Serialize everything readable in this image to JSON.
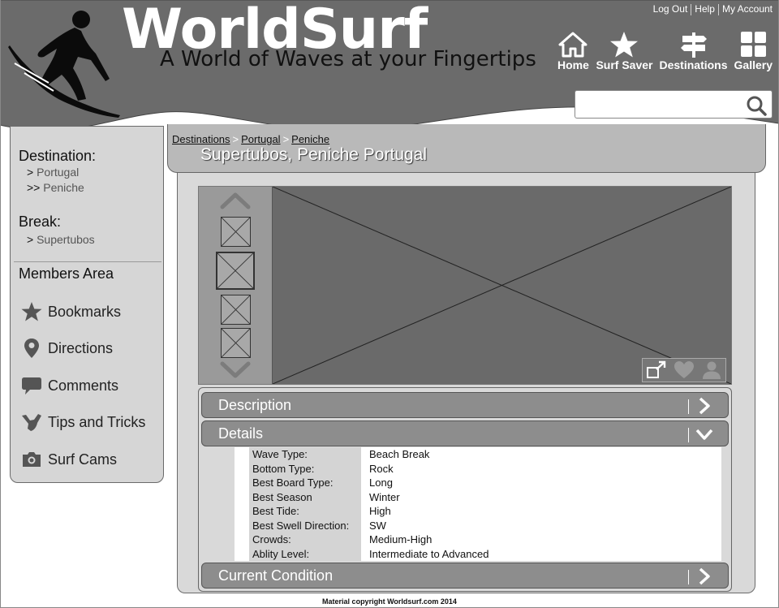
{
  "header": {
    "logo": "WorldSurf",
    "tagline": "A World of Waves at your Fingertips",
    "top_links": [
      "Log Out",
      "Help",
      "My Account"
    ],
    "nav": [
      {
        "label": "Home",
        "icon": "home-icon"
      },
      {
        "label": "Surf Saver",
        "icon": "star-icon"
      },
      {
        "label": "Destinations",
        "icon": "signpost-icon"
      },
      {
        "label": "Gallery",
        "icon": "grid-icon"
      }
    ],
    "search": {
      "value": "",
      "placeholder": ""
    }
  },
  "sidebar": {
    "destination_heading": "Destination:",
    "destination_items": [
      {
        "prefix": ">",
        "label": "Portugal"
      },
      {
        "prefix": ">>",
        "label": "Peniche"
      }
    ],
    "break_heading": "Break:",
    "break_items": [
      {
        "prefix": ">",
        "label": "Supertubos"
      }
    ],
    "members_heading": "Members Area",
    "members": [
      {
        "label": "Bookmarks",
        "icon": "star-icon"
      },
      {
        "label": "Directions",
        "icon": "map-pin-icon"
      },
      {
        "label": "Comments",
        "icon": "speech-bubble-icon"
      },
      {
        "label": "Tips and Tricks",
        "icon": "shaka-hand-icon"
      },
      {
        "label": "Surf Cams",
        "icon": "camera-icon"
      }
    ]
  },
  "breadcrumb": [
    "Destinations",
    "Portugal",
    "Peniche"
  ],
  "breadcrumb_sep": ">",
  "page_title": "Supertubos, Peniche Portugal",
  "accordion": {
    "description": "Description",
    "details": "Details",
    "current_condition": "Current Condition"
  },
  "details": [
    {
      "key": "Wave Type:",
      "value": "Beach Break"
    },
    {
      "key": "Bottom Type:",
      "value": "Rock"
    },
    {
      "key": "Best Board Type:",
      "value": "Long"
    },
    {
      "key": "Best Season",
      "value": "Winter"
    },
    {
      "key": "Best Tide:",
      "value": "High"
    },
    {
      "key": "Best Swell Direction:",
      "value": "SW"
    },
    {
      "key": "Crowds:",
      "value": "Medium-High"
    },
    {
      "key": "Ablity Level:",
      "value": "Intermediate to Advanced"
    }
  ],
  "footer": "Material copyright Worldsurf.com 2014",
  "colors": {
    "header_bg": "#6b6b6b",
    "sidebar_bg": "#d6d6d6",
    "panel_bg": "#d9d9d9",
    "accordion_bg": "#8d8d8d",
    "gallery_dark": "#6a6a6a"
  }
}
